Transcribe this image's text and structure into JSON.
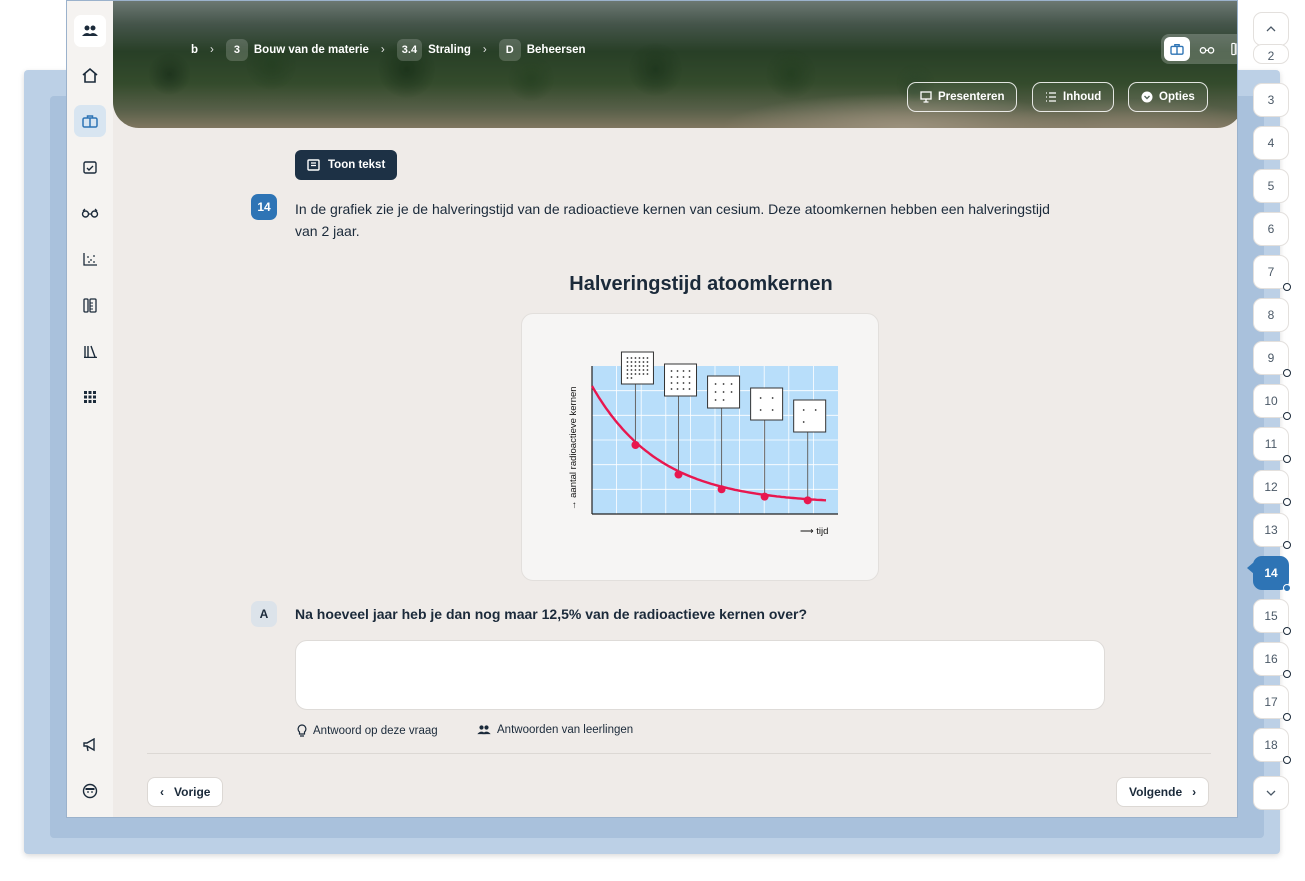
{
  "breadcrumb": {
    "items": [
      {
        "label": "b"
      },
      {
        "num": "3",
        "label": "Bouw van de materie"
      },
      {
        "num": "3.4",
        "label": "Straling"
      },
      {
        "num": "D",
        "label": "Beheersen"
      }
    ]
  },
  "header": {
    "presenteren_label": "Presenteren",
    "inhoud_label": "Inhoud",
    "opties_label": "Opties"
  },
  "content": {
    "toon_tekst_label": "Toon tekst",
    "question_number": "14",
    "question_text": "In de grafiek zie je de halveringstijd van de radioactieve kernen van cesium. Deze atoomkernen hebben een halveringstijd van 2 jaar.",
    "figure_title": "Halveringstijd atoomkernen",
    "sub_label": "A",
    "sub_question": "Na hoeveel jaar heb je dan nog maar 12,5% van de radioactieve kernen over?",
    "answer_value": "",
    "hint_label": "Antwoord op deze vraag",
    "students_label": "Antwoorden van leerlingen"
  },
  "chart_data": {
    "type": "line",
    "title": "",
    "ylabel": "aantal radioactieve kernen",
    "xlabel": "tijd",
    "x": [
      0,
      1,
      2,
      3,
      4,
      5
    ],
    "values": [
      1.0,
      0.5,
      0.25,
      0.125,
      0.0625,
      0.03125
    ],
    "grid": true,
    "markers_at_halvings": [
      1,
      2,
      3,
      4,
      5
    ]
  },
  "navigation": {
    "prev_label": "Vorige",
    "next_label": "Volgende"
  },
  "pager": {
    "pages": [
      "2",
      "3",
      "4",
      "5",
      "6",
      "7",
      "8",
      "9",
      "10",
      "11",
      "12",
      "13",
      "14",
      "15",
      "16",
      "17",
      "18"
    ],
    "current": "14",
    "marked": [
      "7",
      "9",
      "10",
      "11",
      "12",
      "13",
      "14",
      "15",
      "16",
      "17",
      "18"
    ]
  },
  "colors": {
    "accent": "#2e74b5",
    "dark_button": "#1d3145",
    "chart_bg": "#b8defa",
    "curve": "#e8174f"
  }
}
